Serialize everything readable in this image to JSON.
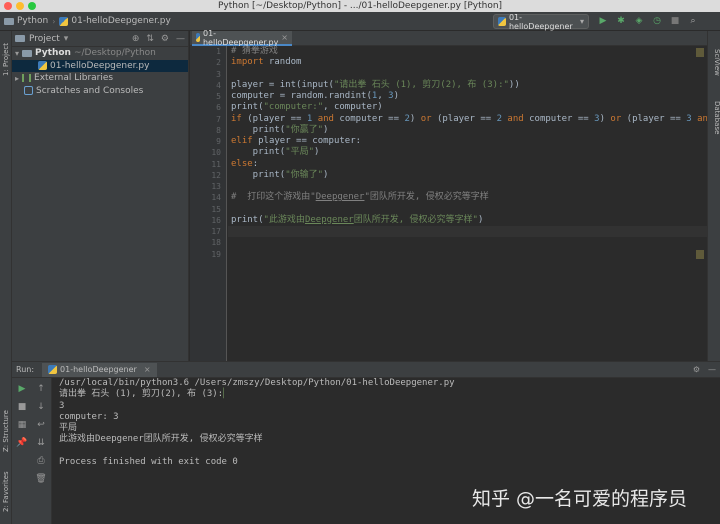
{
  "window": {
    "title": "Python [~/Desktop/Python] - .../01-helloDeepgener.py [Python]"
  },
  "navbar": {
    "crumb_project": "Python",
    "crumb_file": "01-helloDeepgener.py",
    "run_config": "01-helloDeepgener"
  },
  "sidebar_tabs": {
    "project": "1: Project",
    "structure": "Z: Structure",
    "favorites": "2: Favorites"
  },
  "right_tabs": {
    "sciview": "SciView",
    "database": "Database"
  },
  "project_panel": {
    "title": "Project",
    "tree": [
      {
        "label": "Python",
        "detail": "~/Desktop/Python"
      },
      {
        "label": "01-helloDeepgener.py"
      },
      {
        "label": "External Libraries"
      },
      {
        "label": "Scratches and Consoles"
      }
    ]
  },
  "editor": {
    "tab_label": "01-helloDeepgener.py",
    "line_numbers": [
      "1",
      "2",
      "3",
      "4",
      "5",
      "6",
      "7",
      "8",
      "9",
      "10",
      "11",
      "12",
      "13",
      "14",
      "15",
      "16",
      "17",
      "18",
      "19"
    ]
  },
  "run_panel": {
    "label": "Run:",
    "tab_label": "01-helloDeepgener",
    "output": [
      "/usr/local/bin/python3.6 /Users/zmszy/Desktop/Python/01-helloDeepgener.py",
      "请出拳 石头 (1), 剪刀(2), 布 (3):",
      "3",
      "computer: 3",
      "平局",
      "此游戏由Deepgener团队所开发, 侵权必究等字样",
      "",
      "Process finished with exit code 0"
    ]
  },
  "watermark": "知乎 @一名可爱的程序员",
  "colors": {
    "keyword": "#cc7832",
    "string": "#6a8759",
    "number": "#6897bb",
    "comment": "#808080",
    "text": "#a9b7c6",
    "background": "#2b2b2b",
    "panel": "#3c3f41"
  }
}
